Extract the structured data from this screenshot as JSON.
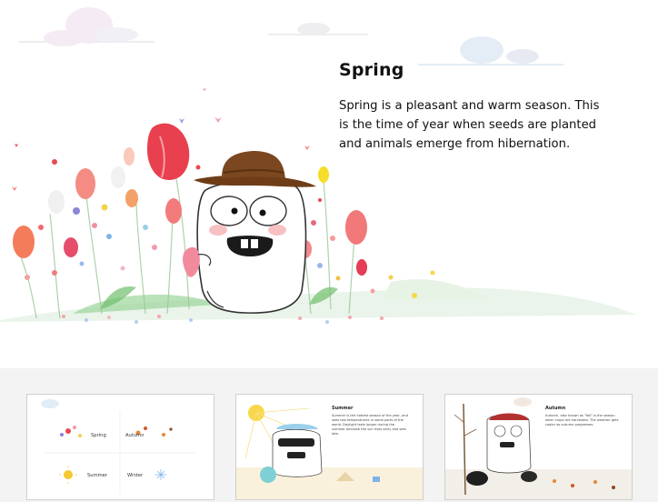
{
  "main_slide": {
    "title": "Spring",
    "body": "Spring is a pleasant and warm season. This is the time of year when seeds are planted and animals emerge from hibernation."
  },
  "thumbnails": [
    {
      "seasons": [
        "Spring",
        "Autumn",
        "Summer",
        "Winter"
      ]
    },
    {
      "title": "Summer",
      "body": "Summer is the hottest season of the year, and sees two temperatures in some parts of the world. Daylight lasts longer during the summer because the sun rises early and sets late."
    },
    {
      "title": "Autumn",
      "body": "Autumn, also known as \"fall\" is the season when crops are harvested. The weather gets cooler as autumn progresses."
    }
  ]
}
